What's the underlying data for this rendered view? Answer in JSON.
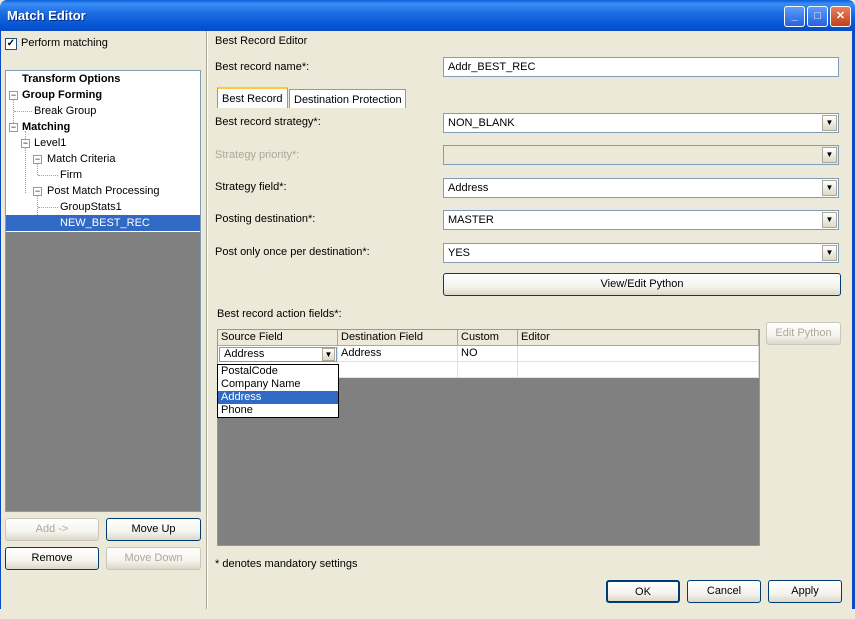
{
  "window": {
    "title": "Match Editor"
  },
  "left": {
    "perform_matching_label": "Perform matching",
    "perform_matching_checked": true,
    "tree": [
      {
        "label": "Transform Options",
        "level": 0,
        "bold": true
      },
      {
        "label": "Group Forming",
        "level": 0,
        "bold": true
      },
      {
        "label": "Break Group",
        "level": 1,
        "bold": false
      },
      {
        "label": "Matching",
        "level": 0,
        "bold": true
      },
      {
        "label": "Level1",
        "level": 1,
        "bold": false
      },
      {
        "label": "Match Criteria",
        "level": 2,
        "bold": false
      },
      {
        "label": "Firm",
        "level": 3,
        "bold": false
      },
      {
        "label": "Post Match Processing",
        "level": 2,
        "bold": false
      },
      {
        "label": "GroupStats1",
        "level": 3,
        "bold": false
      },
      {
        "label": "NEW_BEST_REC",
        "level": 3,
        "bold": false,
        "selected": true
      }
    ],
    "buttons": {
      "add": "Add ->",
      "move_up": "Move Up",
      "remove": "Remove",
      "move_down": "Move Down"
    }
  },
  "editor": {
    "section_title": "Best Record Editor",
    "name_label": "Best record name*:",
    "name_value": "Addr_BEST_REC",
    "tabs": [
      "Best Record",
      "Destination Protection"
    ],
    "strategy_label": "Best record strategy*:",
    "strategy_value": "NON_BLANK",
    "priority_label": "Strategy priority*:",
    "priority_value": "",
    "field_label": "Strategy field*:",
    "field_value": "Address",
    "posting_label": "Posting destination*:",
    "posting_value": "MASTER",
    "once_label": "Post only once per destination*:",
    "once_value": "YES",
    "view_edit_python": "View/Edit Python",
    "action_fields_label": "Best record action fields*:",
    "edit_python": "Edit Python",
    "grid": {
      "columns": [
        "Source Field",
        "Destination Field",
        "Custom",
        "Editor"
      ],
      "row": {
        "source": "Address",
        "destination": "Address",
        "custom": "NO",
        "editor": ""
      }
    },
    "dropdown_options": [
      "PostalCode",
      "Company Name",
      "Address",
      "Phone"
    ],
    "dropdown_selected": "Address",
    "mandatory_note": "* denotes mandatory settings"
  },
  "footer": {
    "ok": "OK",
    "cancel": "Cancel",
    "apply": "Apply"
  }
}
